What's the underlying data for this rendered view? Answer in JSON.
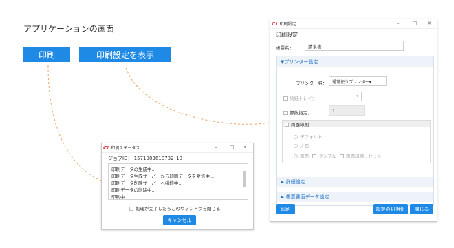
{
  "heading": "アプリケーションの画面",
  "buttons": {
    "print": "印刷",
    "show_settings": "印刷設定を表示"
  },
  "status_window": {
    "title": "印刷ステータス",
    "job_id": "ジョブID： 1571903610732_10",
    "log_lines": [
      "印刷データの生成中...",
      "印刷データ生成サーバーから印刷データを受信中...",
      "印刷データ削除サーバーへ接続中...",
      "印刷データの削除中...",
      "印刷中..."
    ],
    "close_checkbox_label": "処理が完了したらこのウィンドウを閉じる",
    "cancel_label": "キャンセル"
  },
  "settings_window": {
    "title": "印刷設定",
    "heading": "印刷設定",
    "form_name_label": "帳票名：",
    "form_name_value": "請求書",
    "printer_section": "▼プリンター設定",
    "printer_label": "プリンター名：",
    "printer_value": "通常使うプリンター▾",
    "tray_label": "給紙トレイ：",
    "copies_label": "部数指定：",
    "copies_value": "1",
    "duplex_label": "両面印刷",
    "duplex_options": [
      "デフォルト",
      "片面"
    ],
    "duplex_row": [
      "両面",
      "タンブル",
      "両面印刷リセット"
    ],
    "detail_section": "► 詳細設定",
    "form_data_section": "► 帳票書面データ設定",
    "print_button": "印刷",
    "reset_button": "設定の初期化",
    "close_button": "閉じる"
  },
  "window_controls": {
    "minimize": "–",
    "maximize": "□",
    "close": "✕"
  },
  "colors": {
    "accent": "#1e8ae6",
    "connector": "#f0a35e",
    "logo": "#d8262b"
  }
}
